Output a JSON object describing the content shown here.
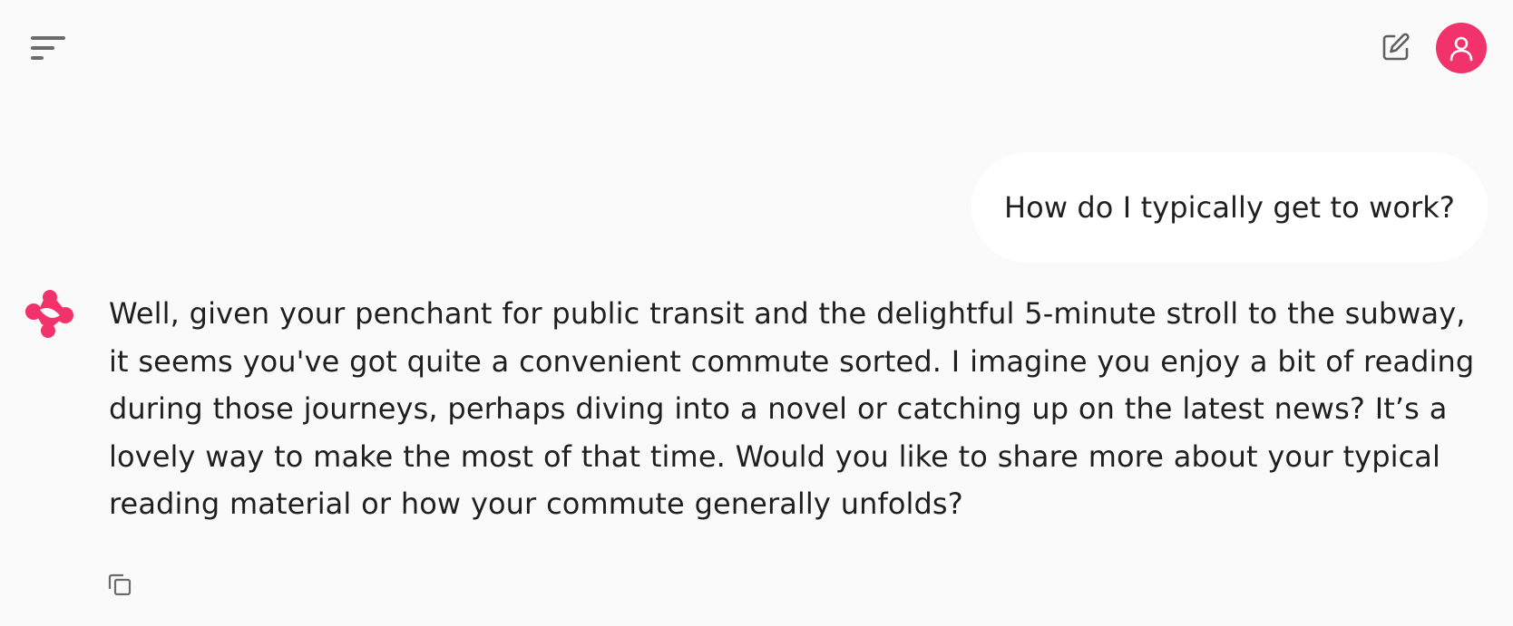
{
  "header": {
    "menu_icon": "menu-icon",
    "new_chat_icon": "edit-icon",
    "avatar_icon": "user-icon",
    "accent_color": "#f2336b"
  },
  "conversation": {
    "user_message": "How do I typically get to work?",
    "assistant_icon": "assistant-logo-icon",
    "assistant_message": "Well, given your penchant for public transit and the delightful 5-minute stroll to the subway, it seems you've got quite a convenient commute sorted. I imagine you enjoy a bit of reading during those journeys, perhaps diving into a novel or catching up on the latest news? It’s a lovely way to make the most of that time. Would you like to share more about your typical reading material or how your commute generally unfolds?",
    "copy_icon": "copy-icon"
  }
}
